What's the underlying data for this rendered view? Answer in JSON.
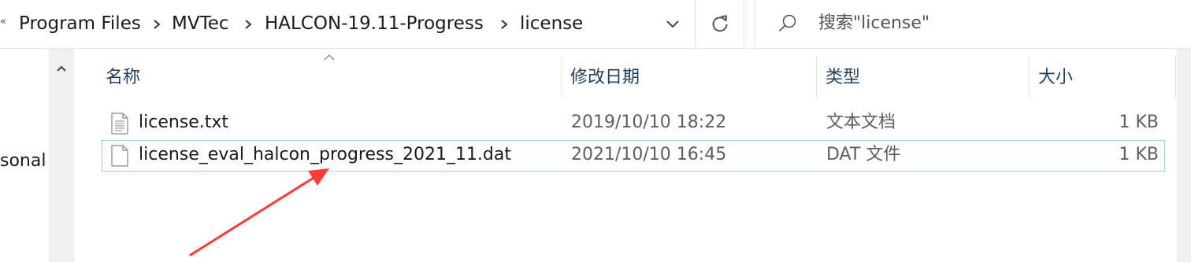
{
  "address_bar": {
    "overflow_glyph": "«",
    "crumbs": [
      "Program Files",
      "MVTec",
      "HALCON-19.11-Progress",
      "license"
    ]
  },
  "search": {
    "placeholder": "搜索\"license\""
  },
  "nav_pane": {
    "partial_label": "sonal"
  },
  "columns": {
    "name": "名称",
    "date": "修改日期",
    "type": "类型",
    "size": "大小"
  },
  "files": [
    {
      "name": "license.txt",
      "date": "2019/10/10 18:22",
      "type": "文本文档",
      "size": "1 KB",
      "icon": "text-file-icon"
    },
    {
      "name": "license_eval_halcon_progress_2021_11.dat",
      "date": "2021/10/10 16:45",
      "type": "DAT 文件",
      "size": "1 KB",
      "icon": "blank-file-icon"
    }
  ],
  "colors": {
    "annotation_arrow": "#ff3b3b",
    "selection_border": "#9ed3e3"
  }
}
